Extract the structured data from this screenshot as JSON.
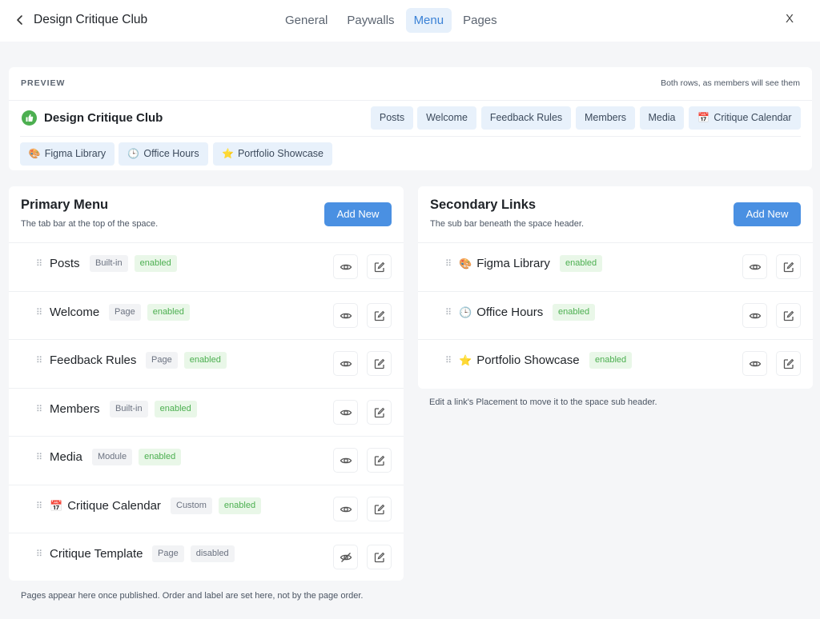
{
  "header": {
    "title": "Design Critique Club",
    "tabs": [
      "General",
      "Paywalls",
      "Menu",
      "Pages"
    ],
    "active_tab": "Menu",
    "close_label": "X"
  },
  "preview": {
    "label": "PREVIEW",
    "note": "Both rows, as members will see them",
    "space_name": "Design Critique Club",
    "space_icon": "thumbs-up-icon",
    "row1": [
      {
        "label": "Posts",
        "emoji": ""
      },
      {
        "label": "Welcome",
        "emoji": ""
      },
      {
        "label": "Feedback Rules",
        "emoji": ""
      },
      {
        "label": "Members",
        "emoji": ""
      },
      {
        "label": "Media",
        "emoji": ""
      },
      {
        "label": "Critique Calendar",
        "emoji": "📅"
      }
    ],
    "row2": [
      {
        "label": "Figma Library",
        "emoji": "🎨"
      },
      {
        "label": "Office Hours",
        "emoji": "🕒"
      },
      {
        "label": "Portfolio Showcase",
        "emoji": "⭐"
      }
    ]
  },
  "primary": {
    "title": "Primary Menu",
    "subtitle": "The tab bar at the top of the space.",
    "add_label": "Add New",
    "items": [
      {
        "label": "Posts",
        "emoji": "",
        "type": "Built-in",
        "status": "enabled",
        "visible": true
      },
      {
        "label": "Welcome",
        "emoji": "",
        "type": "Page",
        "status": "enabled",
        "visible": true
      },
      {
        "label": "Feedback Rules",
        "emoji": "",
        "type": "Page",
        "status": "enabled",
        "visible": true
      },
      {
        "label": "Members",
        "emoji": "",
        "type": "Built-in",
        "status": "enabled",
        "visible": true
      },
      {
        "label": "Media",
        "emoji": "",
        "type": "Module",
        "status": "enabled",
        "visible": true
      },
      {
        "label": "Critique Calendar",
        "emoji": "📅",
        "type": "Custom",
        "status": "enabled",
        "visible": true
      },
      {
        "label": "Critique Template",
        "emoji": "",
        "type": "Page",
        "status": "disabled",
        "visible": false
      }
    ],
    "footnote": "Pages appear here once published. Order and label are set here, not by the page order."
  },
  "secondary": {
    "title": "Secondary Links",
    "subtitle": "The sub bar beneath the space header.",
    "add_label": "Add New",
    "items": [
      {
        "label": "Figma Library",
        "emoji": "🎨",
        "status": "enabled",
        "visible": true
      },
      {
        "label": "Office Hours",
        "emoji": "🕒",
        "status": "enabled",
        "visible": true
      },
      {
        "label": "Portfolio Showcase",
        "emoji": "⭐",
        "status": "enabled",
        "visible": true
      }
    ],
    "footnote": "Edit a link's Placement to move it to the space sub header."
  },
  "colors": {
    "accent": "#4a90e2",
    "active_tab_bg": "#e6f0fb",
    "enabled_green": "#4caf50",
    "chip_bg": "#e8f1fb"
  }
}
